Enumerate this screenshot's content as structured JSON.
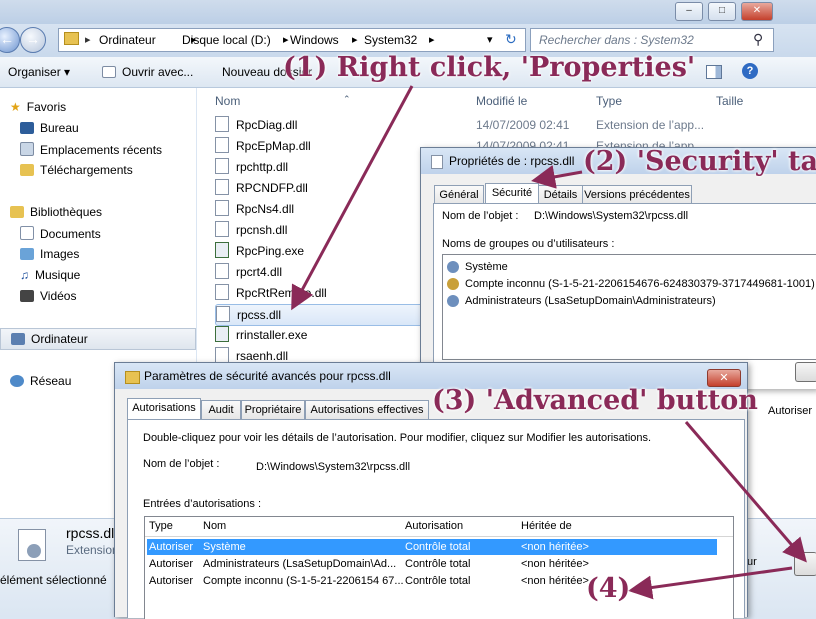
{
  "explorer": {
    "window_controls": [
      "–",
      "□",
      "✕"
    ],
    "breadcrumb": [
      "Ordinateur",
      "Disque local (D:)",
      "Windows",
      "System32"
    ],
    "search_placeholder": "Rechercher dans : System32",
    "toolbar": {
      "organize": "Organiser",
      "open_with": "Ouvrir avec...",
      "new_folder": "Nouveau dossier"
    },
    "sidebar": {
      "favorites": "Favoris",
      "favorites_items": [
        "Bureau",
        "Emplacements récents",
        "Téléchargements"
      ],
      "libraries": "Bibliothèques",
      "libraries_items": [
        "Documents",
        "Images",
        "Musique",
        "Vidéos"
      ],
      "computer": "Ordinateur",
      "network": "Réseau"
    },
    "columns": {
      "name": "Nom",
      "modified": "Modifié le",
      "type": "Type",
      "size": "Taille"
    },
    "files": [
      {
        "name": "RpcDiag.dll",
        "date": "14/07/2009 02:41",
        "type": "Extension de l’app..."
      },
      {
        "name": "RpcEpMap.dll",
        "date": "14/07/2009 02:41",
        "type": "Extension de l’app..."
      },
      {
        "name": "rpchttp.dll",
        "date": "",
        "type": ""
      },
      {
        "name": "RPCNDFP.dll",
        "date": "",
        "type": ""
      },
      {
        "name": "RpcNs4.dll",
        "date": "",
        "type": ""
      },
      {
        "name": "rpcnsh.dll",
        "date": "",
        "type": ""
      },
      {
        "name": "RpcPing.exe",
        "date": "",
        "type": ""
      },
      {
        "name": "rpcrt4.dll",
        "date": "",
        "type": ""
      },
      {
        "name": "RpcRtRemote.dll",
        "date": "",
        "type": ""
      },
      {
        "name": "rpcss.dll",
        "date": "",
        "type": ""
      },
      {
        "name": "rrinstaller.exe",
        "date": "",
        "type": ""
      },
      {
        "name": "rsaenh.dll",
        "date": "",
        "type": ""
      }
    ],
    "details": {
      "filename": "rpcss.dll",
      "filetype": "Extension",
      "status": "élément sélectionné"
    }
  },
  "properties": {
    "title": "Propriétés de : rpcss.dll",
    "tabs": [
      "Général",
      "Sécurité",
      "Détails",
      "Versions précédentes"
    ],
    "object_label": "Nom de l’objet :",
    "object_value": "D:\\Windows\\System32\\rpcss.dll",
    "groups_label": "Noms de groupes ou d’utilisateurs :",
    "groups": [
      "Système",
      "Compte inconnu (S-1-5-21-2206154676-624830379-3717449681-1001)",
      "Administrateurs (LsaSetupDomain\\Administrateurs)"
    ],
    "allow_label": "Autoriser"
  },
  "advanced": {
    "title": "Paramètres de sécurité avancés pour rpcss.dll",
    "tabs": [
      "Autorisations",
      "Audit",
      "Propriétaire",
      "Autorisations effectives"
    ],
    "instruction": "Double-cliquez pour voir les détails de l’autorisation. Pour modifier, cliquez sur Modifier les autorisations.",
    "object_label": "Nom de l’objet :",
    "object_value": "D:\\Windows\\System32\\rpcss.dll",
    "entries_label": "Entrées d’autorisations :",
    "columns": [
      "Type",
      "Nom",
      "Autorisation",
      "Héritée de"
    ],
    "rows": [
      [
        "Autoriser",
        "Système",
        "Contrôle total",
        "<non héritée>"
      ],
      [
        "Autoriser",
        "Administrateurs (LsaSetupDomain\\Ad...",
        "Contrôle total",
        "<non héritée>"
      ],
      [
        "Autoriser",
        "Compte inconnu (S-1-5-21-2206154 67...",
        "Contrôle total",
        "<non héritée>"
      ]
    ],
    "close": "✕"
  },
  "behind_text": "z sur",
  "annotations": {
    "step1": "(1) Right click, 'Properties'",
    "step2": "(2) 'Security' tab",
    "step3": "(3) 'Advanced' button",
    "step4": "(4)"
  },
  "colors": {
    "annotation": "#8a2a58",
    "selection": "#3399ff"
  }
}
